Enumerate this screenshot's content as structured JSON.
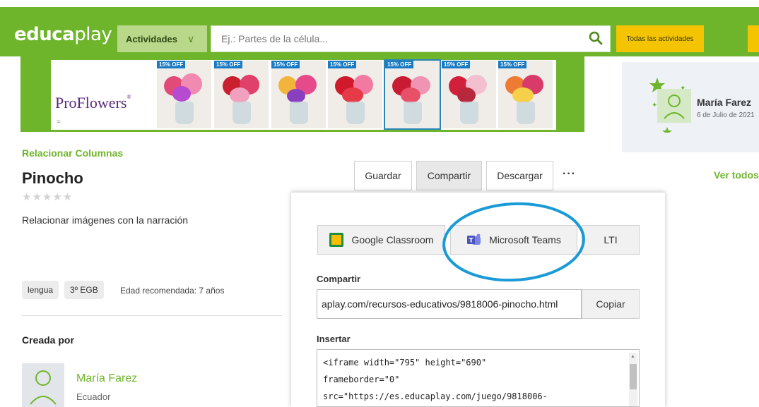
{
  "header": {
    "logo_bold": "educa",
    "logo_thin": "play",
    "category_label": "Actividades",
    "search_placeholder": "Ej.: Partes de la célula...",
    "all_activities_label": "Todas las actividades",
    "brand_color": "#6fb52c",
    "accent_yellow": "#f5c400"
  },
  "banner": {
    "brand": "ProFlowers",
    "brand_mark": "®",
    "menu_glyph": "=",
    "offers": [
      "15% OFF",
      "15% OFF",
      "15% OFF",
      "15% OFF",
      "15% OFF",
      "15% OFF",
      "15% OFF"
    ]
  },
  "sidebar_card": {
    "name": "María Farez",
    "date": "6 de Julio de 2021",
    "see_all": "Ver todos"
  },
  "activity": {
    "type": "Relacionar Columnas",
    "title": "Pinocho",
    "rating_stars": "★★★★★",
    "rating_value": 0,
    "description": "Relacionar imágenes con la narración",
    "tags": [
      "lengua",
      "3º EGB"
    ],
    "age": "Edad recomendada: 7 años",
    "created_by_label": "Creada por",
    "author_name": "María Farez",
    "author_country": "Ecuador"
  },
  "actions": {
    "save": "Guardar",
    "share": "Compartir",
    "download": "Descargar",
    "more": "···"
  },
  "share_panel": {
    "google_classroom": "Google Classroom",
    "microsoft_teams": "Microsoft Teams",
    "lti": "LTI",
    "share_label": "Compartir",
    "share_url": "aplay.com/recursos-educativos/9818006-pinocho.html",
    "copy": "Copiar",
    "embed_label": "Insertar",
    "embed_code": "<iframe width=\"795\" height=\"690\"\nframeborder=\"0\"\nsrc=\"https://es.educaplay.com/juego/9818006-",
    "highlight_color": "#1a9ad6"
  }
}
